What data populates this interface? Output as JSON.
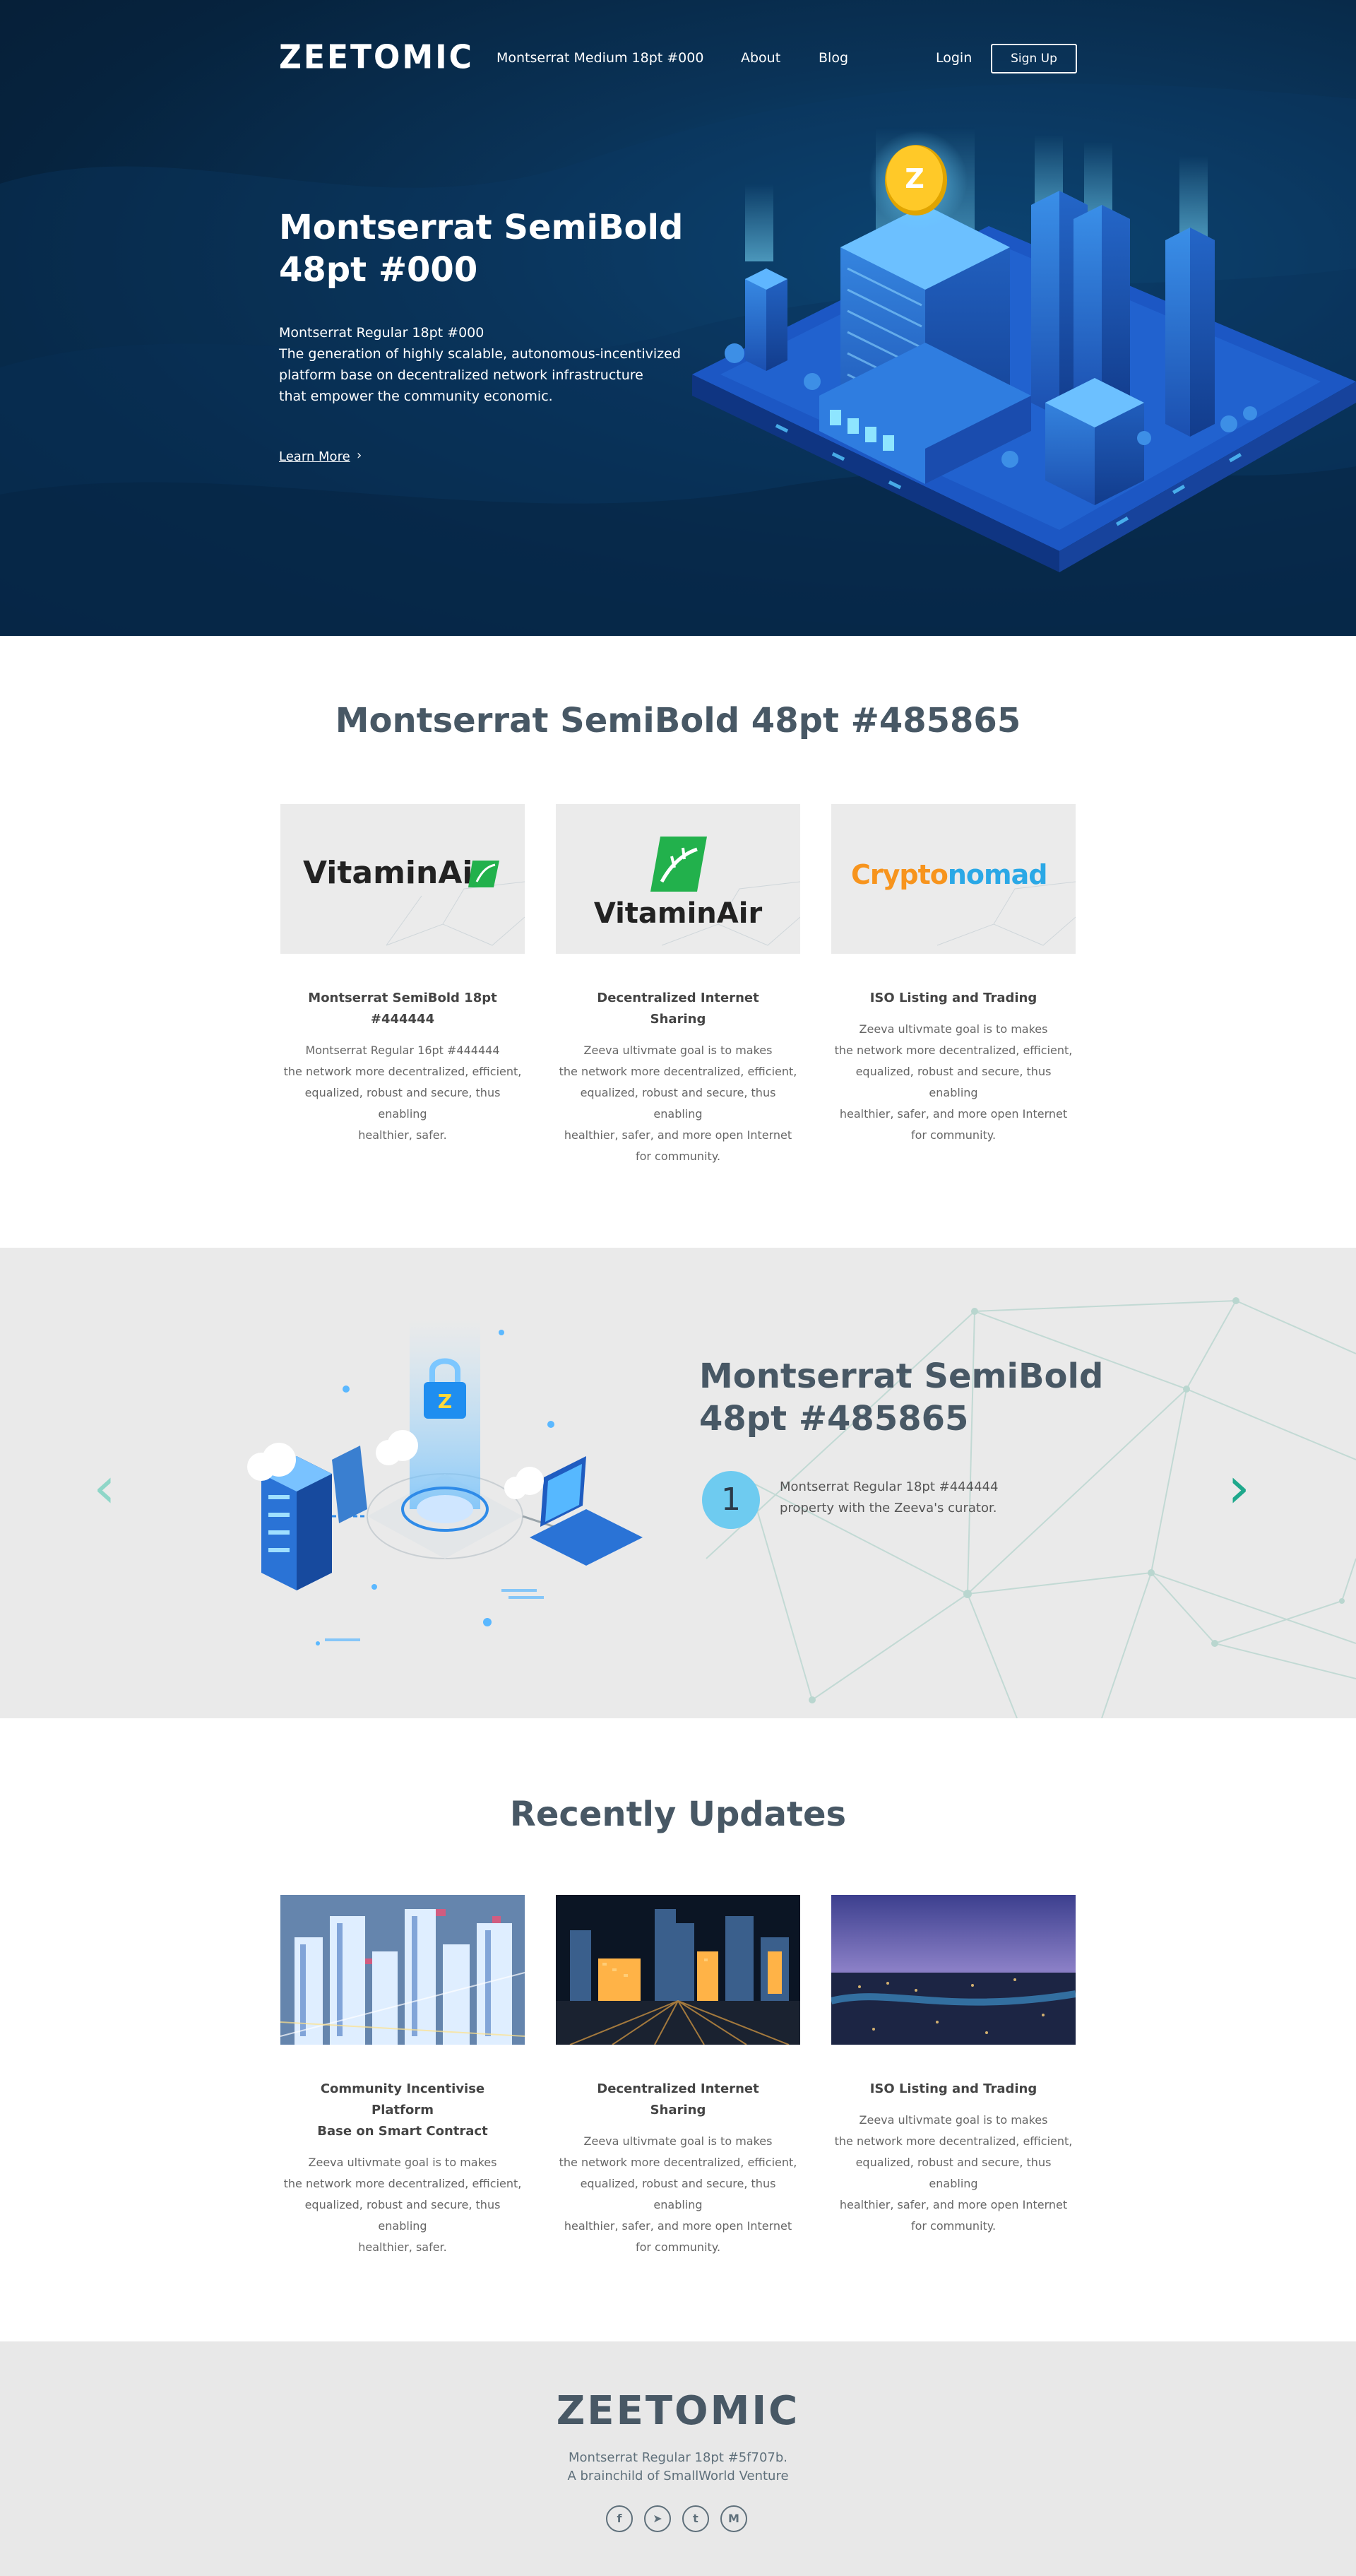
{
  "header": {
    "logo": "ZEETOMIC",
    "nav": [
      "Montserrat Medium 18pt #000",
      "About",
      "Blog"
    ],
    "login": "Login",
    "signup": "Sign Up"
  },
  "hero": {
    "title_line1": "Montserrat SemiBold",
    "title_line2": "48pt #000",
    "sub_lines": [
      "Montserrat Regular 18pt #000",
      "The generation of  highly  scalable, autonomous-incentivized",
      "platform base on decentralized network infrastructure",
      "that empower the community economic."
    ],
    "link": "Learn More",
    "link_arrow": "›",
    "coin_letter": "Z"
  },
  "partners": {
    "title": "Montserrat SemiBold 48pt #485865",
    "cards": [
      {
        "logo": "VitaminAir",
        "title_lines": [
          "Montserrat SemiBold 18pt",
          "#444444"
        ],
        "text_lines": [
          "Montserrat Regular 16pt #444444",
          "the network more decentralized,  efficient,",
          "equalized, robust and secure, thus enabling",
          "healthier, safer."
        ]
      },
      {
        "logo": "VitaminAir",
        "title_lines": [
          "Decentralized Internet Sharing"
        ],
        "text_lines": [
          "Zeeva  ultivmate goal is to makes",
          "the network more decentralized,  efficient,",
          "equalized, robust and secure, thus enabling",
          "healthier, safer, and more open Internet",
          "for community."
        ]
      },
      {
        "logo_a": "Crypto",
        "logo_b": "nomad",
        "title_lines": [
          "ISO Listing and Trading"
        ],
        "text_lines": [
          "Zeeva  ultivmate goal is to makes",
          "the network more decentralized,  efficient,",
          "equalized, robust and secure, thus enabling",
          "healthier, safer, and more open Internet",
          "for community."
        ]
      }
    ]
  },
  "feature": {
    "title_line1": "Montserrat SemiBold",
    "title_line2": "48pt #485865",
    "step_number": "1",
    "step_lines": [
      "Montserrat Regular 18pt #444444",
      "property with the Zeeva's curator."
    ],
    "prev_arrow": "‹",
    "next_arrow": "›",
    "lock_letter": "Z"
  },
  "updates": {
    "title": "Recently Updates",
    "cards": [
      {
        "title_lines": [
          "Community Incentivise Platform",
          "Base on Smart Contract"
        ],
        "text_lines": [
          "Zeeva  ultivmate goal is to makes",
          "the network more decentralized,  efficient,",
          "equalized, robust and secure, thus enabling",
          "healthier, safer."
        ]
      },
      {
        "title_lines": [
          "Decentralized Internet Sharing"
        ],
        "text_lines": [
          "Zeeva  ultivmate goal is to makes",
          "the network more decentralized,  efficient,",
          "equalized, robust and secure, thus enabling",
          "healthier, safer, and more open Internet",
          "for community."
        ]
      },
      {
        "title_lines": [
          "ISO Listing and Trading"
        ],
        "text_lines": [
          "Zeeva  ultivmate goal is to makes",
          "the network more decentralized,  efficient,",
          "equalized, robust and secure, thus enabling",
          "healthier, safer, and more open Internet",
          "for community."
        ]
      }
    ]
  },
  "footer": {
    "logo": "ZEETOMIC",
    "line1": "Montserrat Regular 18pt #5f707b.",
    "line2": "A brainchild of SmallWorld Venture",
    "socials": [
      {
        "icon": "facebook-icon",
        "glyph": "f"
      },
      {
        "icon": "telegram-icon",
        "glyph": "➤"
      },
      {
        "icon": "twitter-icon",
        "glyph": "t"
      },
      {
        "icon": "medium-icon",
        "glyph": "M"
      }
    ]
  },
  "colors": {
    "hero_bg": "#06233e",
    "heading": "#485865",
    "body_text": "#444444",
    "footer_text": "#5f707b",
    "accent_teal": "#1fa88c",
    "accent_green": "#22b14c",
    "accent_orange": "#f7941d",
    "accent_blue": "#2aa8e6",
    "step_circle": "#6ecbf0"
  }
}
